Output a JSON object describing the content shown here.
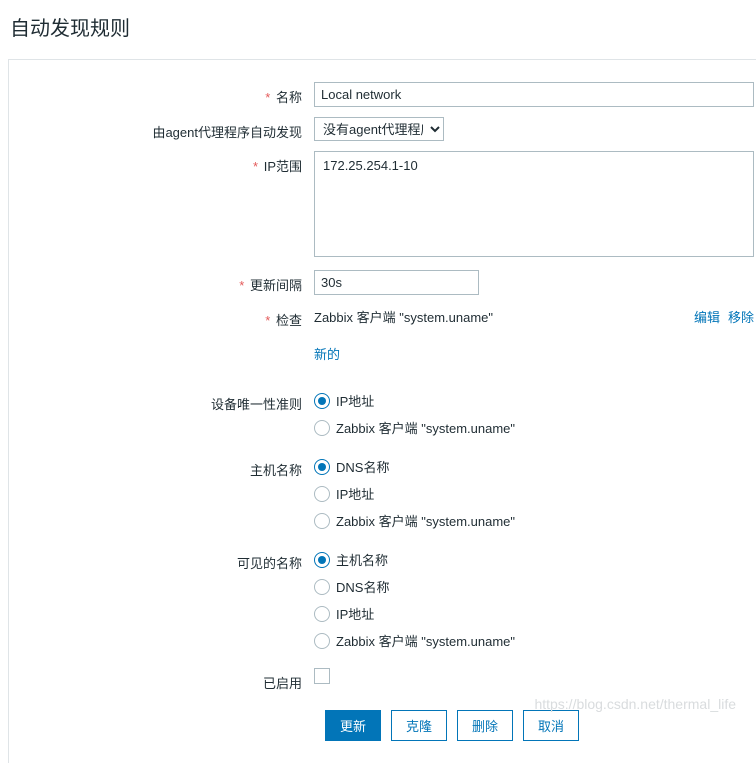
{
  "page": {
    "title": "自动发现规则"
  },
  "form": {
    "name": {
      "label": "名称",
      "value": "Local network"
    },
    "proxy": {
      "label": "由agent代理程序自动发现",
      "selected": "没有agent代理程序"
    },
    "ip_range": {
      "label": "IP范围",
      "value": "172.25.254.1-10"
    },
    "interval": {
      "label": "更新间隔",
      "value": "30s"
    },
    "checks": {
      "label": "检查",
      "items": [
        {
          "text": "Zabbix 客户端 \"system.uname\"",
          "edit": "编辑",
          "remove": "移除"
        }
      ],
      "new_label": "新的"
    },
    "unique": {
      "label": "设备唯一性准则",
      "selected": 0,
      "options": [
        "IP地址",
        "Zabbix 客户端 \"system.uname\""
      ]
    },
    "hostname": {
      "label": "主机名称",
      "selected": 0,
      "options": [
        "DNS名称",
        "IP地址",
        "Zabbix 客户端 \"system.uname\""
      ]
    },
    "visiblename": {
      "label": "可见的名称",
      "selected": 0,
      "options": [
        "主机名称",
        "DNS名称",
        "IP地址",
        "Zabbix 客户端 \"system.uname\""
      ]
    },
    "enabled": {
      "label": "已启用",
      "checked": false
    }
  },
  "buttons": {
    "update": "更新",
    "clone": "克隆",
    "delete": "删除",
    "cancel": "取消"
  },
  "watermark": "https://blog.csdn.net/thermal_life"
}
